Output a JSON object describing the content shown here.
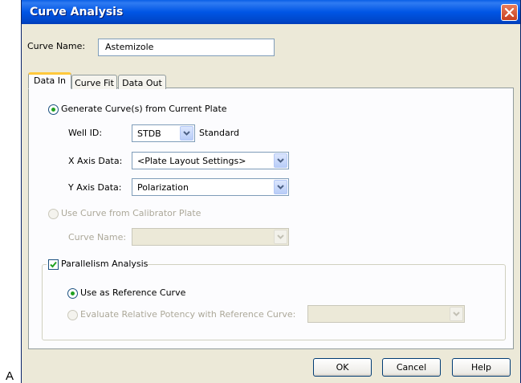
{
  "figure_label": "A",
  "window": {
    "title": "Curve Analysis"
  },
  "curve_name": {
    "label": "Curve Name:",
    "value": "Astemizole"
  },
  "tabs": [
    {
      "label": "Data In"
    },
    {
      "label": "Curve Fit"
    },
    {
      "label": "Data Out"
    }
  ],
  "data_in": {
    "generate_option": {
      "label": "Generate Curve(s) from Current Plate",
      "checked": true
    },
    "well_id": {
      "label": "Well ID:",
      "value": "STDB",
      "description": "Standard"
    },
    "x_axis": {
      "label": "X Axis Data:",
      "value": "<Plate Layout Settings>"
    },
    "y_axis": {
      "label": "Y Axis Data:",
      "value": "Polarization"
    },
    "calibrator_option": {
      "label": "Use Curve from Calibrator Plate",
      "checked": false,
      "enabled": false
    },
    "calibrator_curve_name": {
      "label": "Curve Name:",
      "value": ""
    },
    "parallelism": {
      "label": "Parallelism Analysis",
      "checked": true,
      "reference_option": {
        "label": "Use as Reference Curve",
        "checked": true
      },
      "relative_potency_option": {
        "label": "Evaluate Relative Potency with Reference Curve:",
        "checked": false,
        "enabled": false
      },
      "relative_potency_value": ""
    }
  },
  "buttons": {
    "ok": "OK",
    "cancel": "Cancel",
    "help": "Help"
  },
  "icons": {
    "close": "close-icon",
    "dropdown": "chevron-down-icon",
    "check": "checkmark-icon"
  },
  "colors": {
    "titlebar": "#0055e5",
    "dialog_bg": "#ece9d8",
    "panel_bg": "#fcfcfe",
    "active_tab_accent": "#ffc83c",
    "radio_dot": "#21a121",
    "close_button": "#c8401e"
  }
}
